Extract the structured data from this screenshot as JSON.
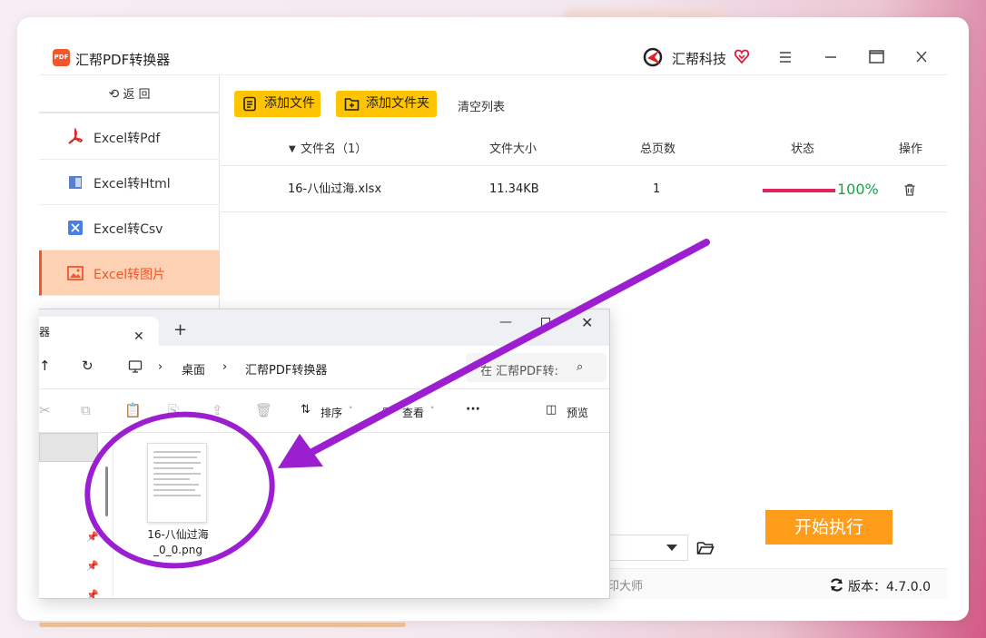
{
  "app": {
    "title": "汇帮PDF转换器",
    "logo_text": "PDF",
    "brand": "汇帮科技",
    "accent": "#f2552a"
  },
  "sidebar": {
    "back_label": "返 回",
    "items": [
      {
        "label": "Excel转Pdf",
        "icon": "pdf-icon",
        "active": false
      },
      {
        "label": "Excel转Html",
        "icon": "html-icon",
        "active": false
      },
      {
        "label": "Excel转Csv",
        "icon": "csv-icon",
        "active": false
      },
      {
        "label": "Excel转图片",
        "icon": "image-icon",
        "active": true
      }
    ]
  },
  "toolbar": {
    "add_file": "添加文件",
    "add_folder": "添加文件夹",
    "clear_list": "清空列表"
  },
  "table": {
    "headers": {
      "name": "文件名（1）",
      "size": "文件大小",
      "pages": "总页数",
      "status": "状态",
      "action": "操作"
    },
    "rows": [
      {
        "name": "16-八仙过海.xlsx",
        "size": "11.34KB",
        "pages": "1",
        "progress": 100,
        "progress_text": "100%"
      }
    ]
  },
  "bottom": {
    "start_button": "开始执行",
    "partial_text": "印大师",
    "version": "版本：4.7.0.0"
  },
  "explorer": {
    "tab_title": "器",
    "breadcrumb": [
      "桌面",
      "汇帮PDF转换器"
    ],
    "search_placeholder": "在 汇帮PDF转:",
    "sort_label": "排序",
    "view_label": "查看",
    "more_label": "···",
    "preview_label": "预览",
    "file_name": "16-八仙过海_0_0.png"
  },
  "annotation": {
    "color": "#9b1fd0"
  }
}
